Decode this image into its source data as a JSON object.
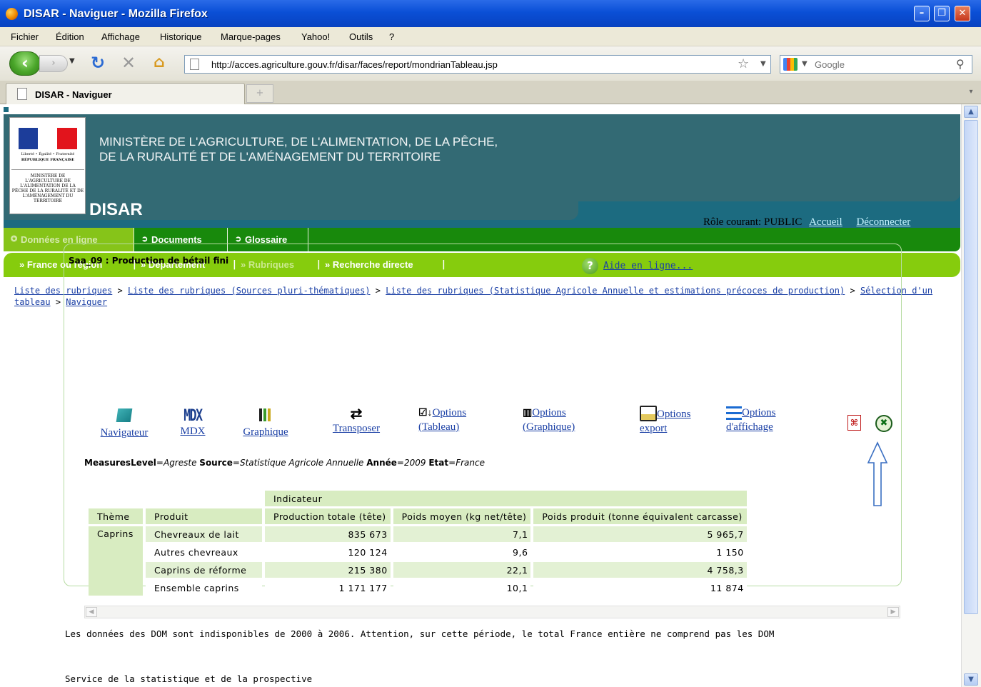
{
  "window": {
    "title": "DISAR - Naviguer - Mozilla Firefox"
  },
  "menubar": [
    "Fichier",
    "Édition",
    "Affichage",
    "Historique",
    "Marque-pages",
    "Yahoo!",
    "Outils",
    "?"
  ],
  "browser": {
    "url": "http://acces.agriculture.gouv.fr/disar/faces/report/mondrianTableau.jsp",
    "search_placeholder": "Google",
    "tab_title": "DISAR - Naviguer",
    "newtab_symbol": "+"
  },
  "header": {
    "ministry_line1": "MINISTÈRE DE L'AGRICULTURE, DE L'ALIMENTATION, DE LA PÊCHE,",
    "ministry_line2": "DE LA RURALITÉ ET DE L'AMÉNAGEMENT DU TERRITOIRE",
    "app_name": "DISAR",
    "logo_motto": "Liberté • Égalité • Fraternité",
    "logo_republic": "RÉPUBLIQUE FRANÇAISE",
    "logo_ministry": "MINISTÈRE DE L'AGRICULTURE DE L'ALIMENTATION DE LA PÊCHE DE LA RURALITÉ ET DE L'AMÉNAGEMENT DU TERRITOIRE",
    "role_label": "Rôle courant: PUBLIC",
    "link_home": "Accueil",
    "link_logout": "Déconnecter"
  },
  "menu_primary": [
    "Données en ligne",
    "Documents",
    "Glossaire"
  ],
  "menu_secondary": [
    "France ou région",
    "Département",
    "Rubriques",
    "Recherche directe"
  ],
  "breadcrumb": {
    "items": [
      "Liste des rubriques",
      "Liste des rubriques (Sources pluri-thématiques)",
      "Liste des rubriques (Statistique Agricole Annuelle et estimations précoces de production)",
      "Sélection d'un tableau",
      "Naviguer"
    ],
    "separator": ">"
  },
  "report": {
    "title": "Saa_09 : Production de bétail fini",
    "help_link": "Aide en ligne...",
    "toolbar": [
      {
        "label1": "Navigateur",
        "label2": ""
      },
      {
        "label1": "MDX",
        "label2": ""
      },
      {
        "label1": "Graphique",
        "label2": ""
      },
      {
        "label1": "Transposer",
        "label2": ""
      },
      {
        "label1": "Options",
        "label2": "(Tableau)"
      },
      {
        "label1": "Options",
        "label2": "(Graphique)"
      },
      {
        "label1": "Options",
        "label2": "export"
      },
      {
        "label1": "Options",
        "label2": "d'affichage"
      }
    ],
    "mdx_icon_text": "MDX",
    "filters": [
      {
        "key": "MeasuresLevel",
        "value": "Agreste"
      },
      {
        "key": "Source",
        "value": "Statistique Agricole Annuelle"
      },
      {
        "key": "Année",
        "value": "2009"
      },
      {
        "key": "Etat",
        "value": "France"
      }
    ],
    "table": {
      "indicator_header": "Indicateur",
      "col_theme": "Thème",
      "col_product": "Produit",
      "measures": [
        "Production totale (tête)",
        "Poids moyen (kg net/tête)",
        "Poids produit (tonne équivalent carcasse)"
      ],
      "theme": "Caprins",
      "rows": [
        {
          "product": "Chevreaux de lait",
          "values": [
            "835 673",
            "7,1",
            "5 965,7"
          ]
        },
        {
          "product": "Autres chevreaux",
          "values": [
            "120 124",
            "9,6",
            "1 150"
          ]
        },
        {
          "product": "Caprins de réforme",
          "values": [
            "215 380",
            "22,1",
            "4 758,3"
          ]
        },
        {
          "product": "Ensemble caprins",
          "values": [
            "1 171 177",
            "10,1",
            "11 874"
          ]
        }
      ]
    },
    "note": "Les données des DOM sont indisponibles de 2000 à 2006. Attention, sur cette période, le total France entière ne comprend pas les DOM",
    "service": "Service de la statistique et de la prospective"
  },
  "colors": {
    "titlebar": "#0a4fd6",
    "header_teal": "#336a74",
    "menu_green": "#18890c",
    "submenu_green": "#86cc0d",
    "table_header": "#d8ecc1",
    "link_blue": "#1a3fa5"
  }
}
